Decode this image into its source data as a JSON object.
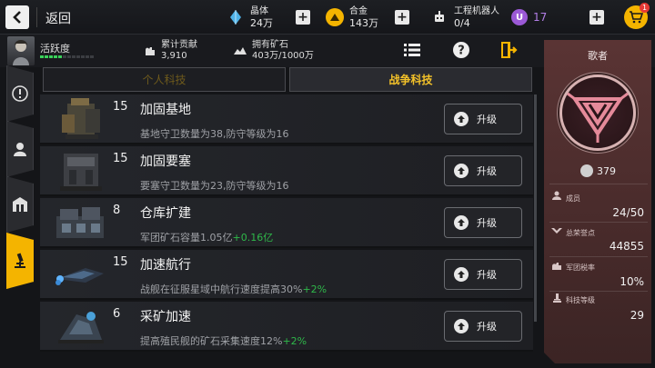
{
  "header": {
    "back_label": "返回",
    "resources": [
      {
        "label": "晶体",
        "value": "24万",
        "icon": "crystal-icon",
        "color": "#4fb3e8"
      },
      {
        "label": "合金",
        "value": "143万",
        "icon": "alloy-icon",
        "color": "#f4b400"
      },
      {
        "label": "工程机器人",
        "value": "0/4",
        "icon": "robot-icon"
      }
    ],
    "premium": {
      "value": "17",
      "icon": "premium-currency-icon",
      "color": "#9b59d6"
    },
    "cart_badge": "1"
  },
  "subbar": {
    "activity_label": "活跃度",
    "activity_level": 5,
    "activity_segments": 12,
    "contribution_label": "累计贡献",
    "contribution_value": "3,910",
    "ore_label": "拥有矿石",
    "ore_value": "403万/1000万"
  },
  "tabs": {
    "personal": "个人科技",
    "war": "战争科技",
    "active": "war"
  },
  "tech_items": [
    {
      "level": "15",
      "name": "加固基地",
      "desc": "基地守卫数量为38,防守等级为16",
      "bonus": "",
      "button": "升级"
    },
    {
      "level": "15",
      "name": "加固要塞",
      "desc": "要塞守卫数量为23,防守等级为16",
      "bonus": "",
      "button": "升级"
    },
    {
      "level": "8",
      "name": "仓库扩建",
      "desc": "军团矿石容量1.05亿",
      "bonus": "+0.16亿",
      "button": "升级"
    },
    {
      "level": "15",
      "name": "加速航行",
      "desc": "战舰在征服星域中航行速度提高30%",
      "bonus": "+2%",
      "button": "升级"
    },
    {
      "level": "6",
      "name": "采矿加速",
      "desc": "提高殖民舰的矿石采集速度12%",
      "bonus": "+2%",
      "button": "升级"
    }
  ],
  "legion": {
    "name": "歌者",
    "power": "379",
    "emblem_color": "#e58a9a",
    "stats": [
      {
        "label": "成员",
        "value": "24/50",
        "icon": "member-icon"
      },
      {
        "label": "总荣誉点",
        "value": "44855",
        "icon": "honor-icon"
      },
      {
        "label": "军团税率",
        "value": "10%",
        "icon": "tax-icon"
      },
      {
        "label": "科技等级",
        "value": "29",
        "icon": "tech-level-icon"
      }
    ]
  }
}
